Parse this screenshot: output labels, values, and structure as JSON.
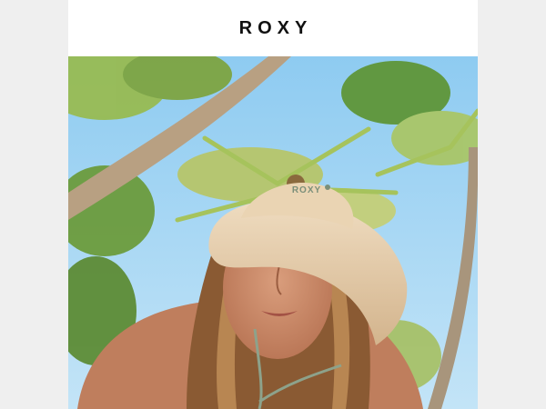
{
  "email": {
    "brand_logo": "ROXY",
    "hat_logo": "ROXY",
    "hero_image": "woman-bucket-hat-palm-trees-photo",
    "colors": {
      "background": "#efefef",
      "card": "#ffffff",
      "sky": "#a7d6f3",
      "hat": "#e2c8a4",
      "skin": "#c98a6a",
      "hair": "#8a5a33",
      "palm": "#8fb54a"
    }
  }
}
